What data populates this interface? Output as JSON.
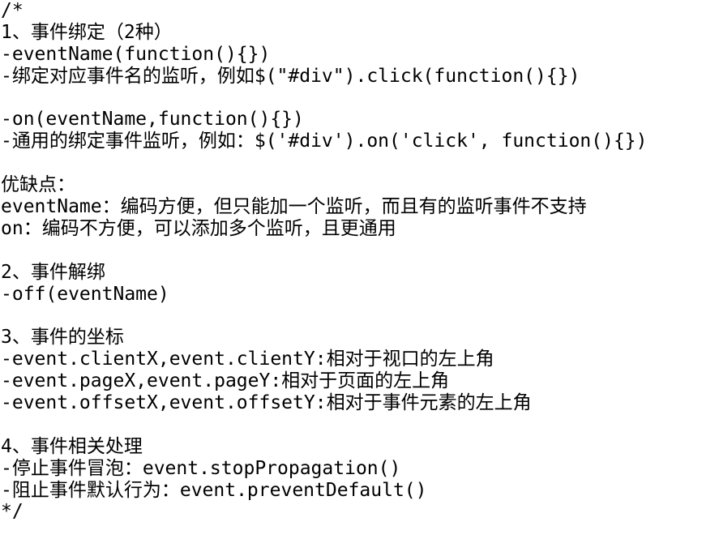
{
  "lines": [
    "/*",
    "1、事件绑定（2种）",
    "-eventName(function(){})",
    "-绑定对应事件名的监听，例如$(\"#div\").click(function(){})",
    "",
    "-on(eventName,function(){})",
    "-通用的绑定事件监听，例如：$('#div').on('click', function(){})",
    "",
    "优缺点：",
    "eventName：编码方便，但只能加一个监听，而且有的监听事件不支持",
    "on：编码不方便，可以添加多个监听，且更通用",
    "",
    "2、事件解绑",
    "-off(eventName)",
    "",
    "3、事件的坐标",
    "-event.clientX,event.clientY:相对于视口的左上角",
    "-event.pageX,event.pageY:相对于页面的左上角",
    "-event.offsetX,event.offsetY:相对于事件元素的左上角",
    "",
    "4、事件相关处理",
    "-停止事件冒泡：event.stopPropagation()",
    "-阻止事件默认行为：event.preventDefault()",
    "*/"
  ]
}
